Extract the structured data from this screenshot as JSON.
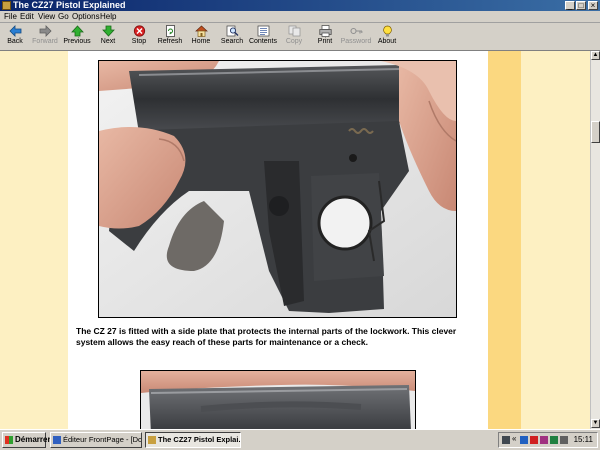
{
  "window": {
    "title": "The CZ27 Pistol Explained"
  },
  "menu": [
    "File",
    "Edit",
    "View",
    "Go",
    "Options",
    "Help"
  ],
  "toolbar": [
    {
      "label": "Back",
      "icon": "back-arrow-icon",
      "enabled": true
    },
    {
      "label": "Forward",
      "icon": "forward-arrow-icon",
      "enabled": false
    },
    {
      "label": "Previous",
      "icon": "previous-arrow-icon",
      "enabled": true
    },
    {
      "label": "Next",
      "icon": "next-arrow-icon",
      "enabled": true
    },
    {
      "label": "Stop",
      "icon": "stop-icon",
      "enabled": true
    },
    {
      "label": "Refresh",
      "icon": "refresh-icon",
      "enabled": true
    },
    {
      "label": "Home",
      "icon": "home-icon",
      "enabled": true
    },
    {
      "label": "Search",
      "icon": "search-icon",
      "enabled": true
    },
    {
      "label": "Contents",
      "icon": "contents-icon",
      "enabled": true
    },
    {
      "label": "Copy",
      "icon": "copy-icon",
      "enabled": false
    },
    {
      "label": "Print",
      "icon": "print-icon",
      "enabled": true
    },
    {
      "label": "Password",
      "icon": "key-icon",
      "enabled": false
    },
    {
      "label": "About",
      "icon": "about-icon",
      "enabled": true
    }
  ],
  "content": {
    "caption": "The CZ 27 is fitted with a side plate that protects the internal parts of the lockwork. This clever system allows the easy reach of these parts for maintenance or a check."
  },
  "taskbar": {
    "start_label": "Démarrer",
    "tasks": [
      {
        "label": "Éditeur FrontPage - [Do...",
        "active": false
      },
      {
        "label": "The CZ27 Pistol Explai...",
        "active": true
      }
    ],
    "clock": "15:11"
  },
  "colors": {
    "titlebar": "#0a246a",
    "page_background": "#ffffff",
    "side_stripe": "#fdf0c2",
    "accent_stripe": "#fbd880"
  }
}
